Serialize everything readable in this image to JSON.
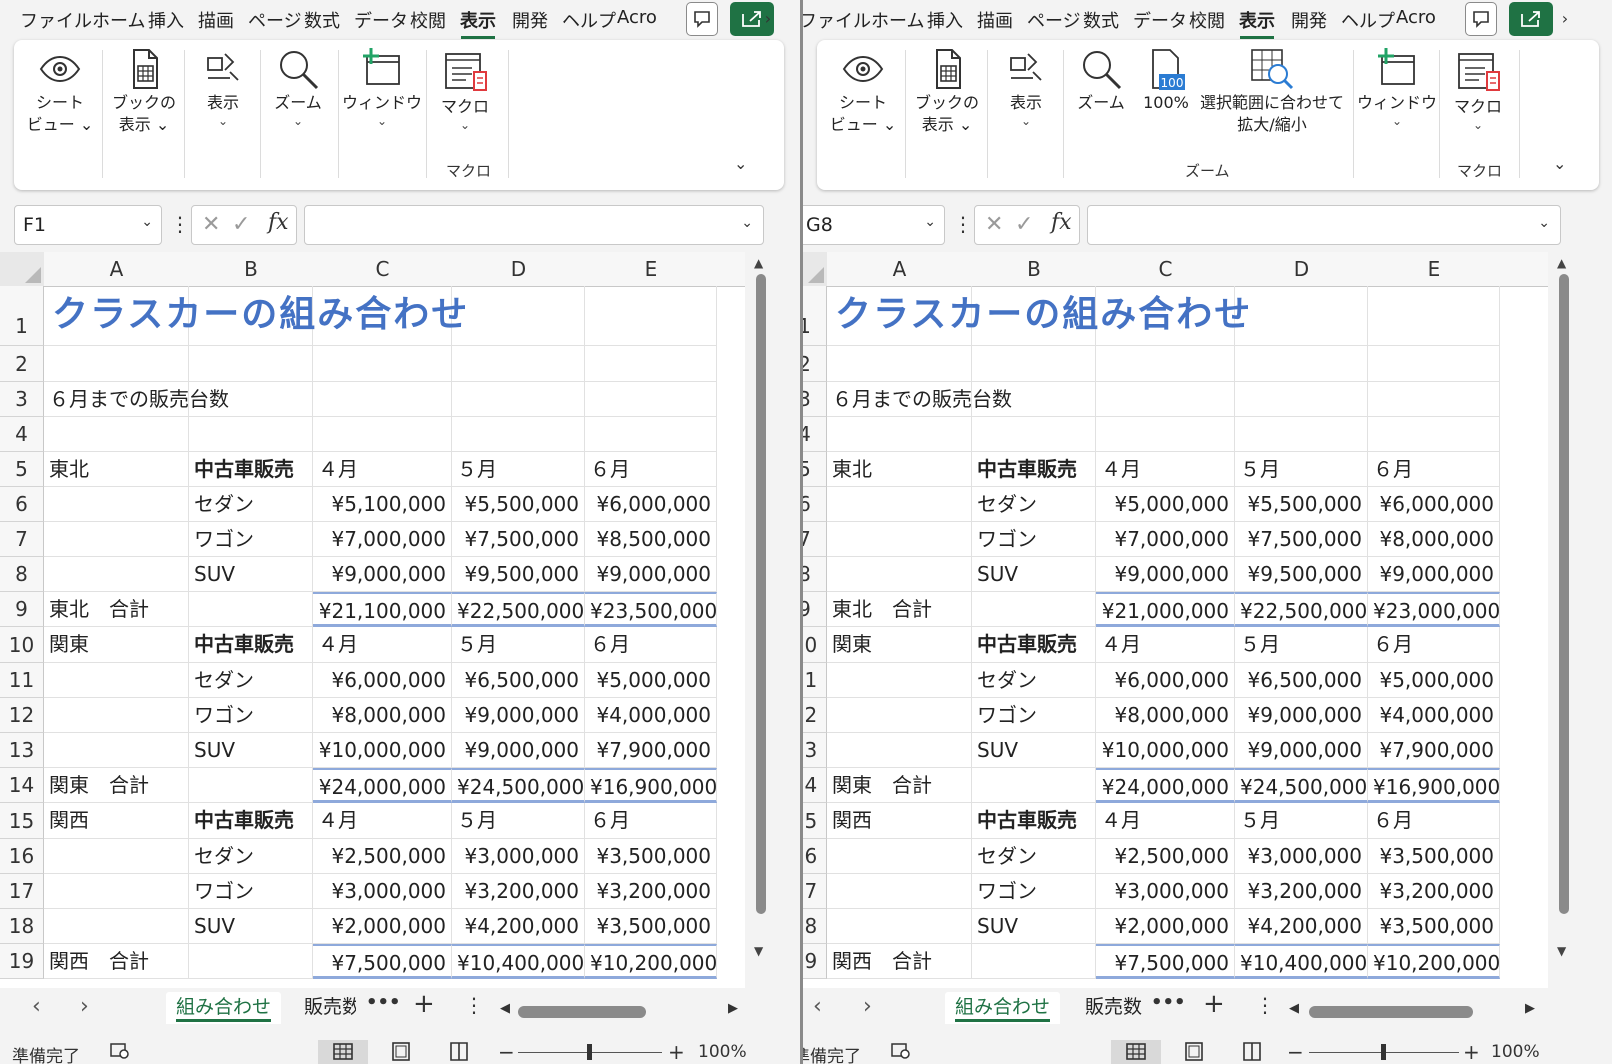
{
  "menu_tabs": [
    "ファイル",
    "ホーム",
    "挿入",
    "描画",
    "ページ",
    "数式",
    "データ",
    "校閲",
    "表示",
    "開発",
    "ヘルプ",
    "Acro"
  ],
  "active_menu": "表示",
  "left": {
    "ribbon": {
      "sheet_view": "シート\nビュー ⌄",
      "book_view": "ブックの\n表示 ⌄",
      "show": "表示",
      "zoom": "ズーム",
      "window": "ウィンドウ",
      "macro": "マクロ",
      "group_macro": "マクロ"
    },
    "name_box": "F1"
  },
  "right": {
    "ribbon": {
      "sheet_view": "シート\nビュー ⌄",
      "book_view": "ブックの\n表示 ⌄",
      "show": "表示",
      "zoom": "ズーム",
      "zoom100": "100%",
      "zoom100_badge": "100",
      "zoom_selection": "選択範囲に合わせて\n拡大/縮小",
      "group_zoom": "ズーム",
      "window": "ウィンドウ",
      "macro": "マクロ",
      "group_macro": "マクロ"
    },
    "name_box": "G8"
  },
  "columns": [
    "A",
    "B",
    "C",
    "D",
    "E"
  ],
  "rows": [
    "1",
    "2",
    "3",
    "4",
    "5",
    "6",
    "7",
    "8",
    "9",
    "10",
    "11",
    "12",
    "13",
    "14",
    "15",
    "16",
    "17",
    "18",
    "19"
  ],
  "sheet": {
    "title": "クラスカーの組み合わせ",
    "subtitle": "６月までの販売台数",
    "header_b": "中古車販売",
    "months": [
      "４月",
      "５月",
      "６月"
    ],
    "types": [
      "セダン",
      "ワゴン",
      "SUV"
    ]
  },
  "left_blocks": [
    {
      "region": "東北",
      "total_label": "東北　合計",
      "rows": [
        [
          "¥5,100,000",
          "¥5,500,000",
          "¥6,000,000"
        ],
        [
          "¥7,000,000",
          "¥7,500,000",
          "¥8,500,000"
        ],
        [
          "¥9,000,000",
          "¥9,500,000",
          "¥9,000,000"
        ]
      ],
      "totals": [
        "¥21,100,000",
        "¥22,500,000",
        "¥23,500,000"
      ]
    },
    {
      "region": "関東",
      "total_label": "関東　合計",
      "rows": [
        [
          "¥6,000,000",
          "¥6,500,000",
          "¥5,000,000"
        ],
        [
          "¥8,000,000",
          "¥9,000,000",
          "¥4,000,000"
        ],
        [
          "¥10,000,000",
          "¥9,000,000",
          "¥7,900,000"
        ]
      ],
      "totals": [
        "¥24,000,000",
        "¥24,500,000",
        "¥16,900,000"
      ]
    },
    {
      "region": "関西",
      "total_label": "関西　合計",
      "rows": [
        [
          "¥2,500,000",
          "¥3,000,000",
          "¥3,500,000"
        ],
        [
          "¥3,000,000",
          "¥3,200,000",
          "¥3,200,000"
        ],
        [
          "¥2,000,000",
          "¥4,200,000",
          "¥3,500,000"
        ]
      ],
      "totals": [
        "¥7,500,000",
        "¥10,400,000",
        "¥10,200,000"
      ]
    }
  ],
  "right_blocks": [
    {
      "region": "東北",
      "total_label": "東北　合計",
      "rows": [
        [
          "¥5,000,000",
          "¥5,500,000",
          "¥6,000,000"
        ],
        [
          "¥7,000,000",
          "¥7,500,000",
          "¥8,000,000"
        ],
        [
          "¥9,000,000",
          "¥9,500,000",
          "¥9,000,000"
        ]
      ],
      "totals": [
        "¥21,000,000",
        "¥22,500,000",
        "¥23,000,000"
      ]
    },
    {
      "region": "関東",
      "total_label": "関東　合計",
      "rows": [
        [
          "¥6,000,000",
          "¥6,500,000",
          "¥5,000,000"
        ],
        [
          "¥8,000,000",
          "¥9,000,000",
          "¥4,000,000"
        ],
        [
          "¥10,000,000",
          "¥9,000,000",
          "¥7,900,000"
        ]
      ],
      "totals": [
        "¥24,000,000",
        "¥24,500,000",
        "¥16,900,000"
      ]
    },
    {
      "region": "関西",
      "total_label": "関西　合計",
      "rows": [
        [
          "¥2,500,000",
          "¥3,000,000",
          "¥3,500,000"
        ],
        [
          "¥3,000,000",
          "¥3,200,000",
          "¥3,200,000"
        ],
        [
          "¥2,000,000",
          "¥4,200,000",
          "¥3,500,000"
        ]
      ],
      "totals": [
        "¥7,500,000",
        "¥10,400,000",
        "¥10,200,000"
      ]
    }
  ],
  "tabs": {
    "left": [
      "組み合わせ",
      "販売数"
    ],
    "right": [
      "組み合わせ",
      "販売数"
    ],
    "more": "•••",
    "add": "+"
  },
  "status": {
    "ready": "準備完了",
    "zoom": "100%"
  },
  "colors": {
    "accent_green": "#1f7244",
    "title_blue": "#4472c4",
    "total_border": "#8ea9db"
  }
}
